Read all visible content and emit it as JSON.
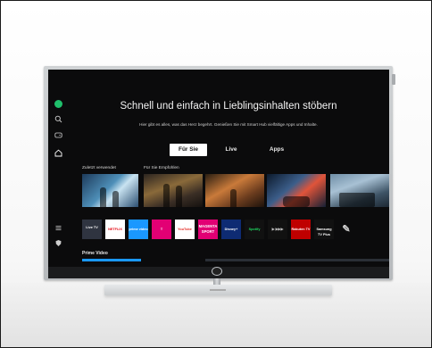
{
  "hero": {
    "headline": "Schnell und einfach in Lieblingsinhalten stöbern",
    "subline": "Hier gibt es alles, was das Herz begehrt. Genießen Sie mit Smart Hub vielfältige Apps und Inhalte."
  },
  "tabs": [
    {
      "label": "Für Sie",
      "active": true
    },
    {
      "label": "Live",
      "active": false
    },
    {
      "label": "Apps",
      "active": false
    }
  ],
  "sections": {
    "recent": "Zuletzt verwendet",
    "recommended": "Für Sie Empfohlen",
    "prime_video": "Prime Video"
  },
  "apps": [
    {
      "name": "Live TV",
      "label": "Live TV"
    },
    {
      "name": "Netflix",
      "label": "NETFLIX"
    },
    {
      "name": "Prime Video",
      "label": "prime video"
    },
    {
      "name": "MagentaTV",
      "label": "T"
    },
    {
      "name": "YouTube",
      "label": "YouTube"
    },
    {
      "name": "MagentaSport",
      "label": "MAGENTA SPORT"
    },
    {
      "name": "Disney+",
      "label": "Disney+"
    },
    {
      "name": "Spotify",
      "label": "Spotify"
    },
    {
      "name": "Rakuten Play",
      "label": "▶ ▶▶▶"
    },
    {
      "name": "Rakuten TV",
      "label": "Rakuten TV"
    },
    {
      "name": "Samsung TV Plus",
      "label": "Samsung TV Plus"
    }
  ],
  "icons": {
    "profile": "profile-icon",
    "search": "search-icon",
    "games": "gamepad-icon",
    "home": "home-icon",
    "menu": "menu-icon",
    "privacy": "shield-icon",
    "edit": "pencil-icon"
  },
  "colors": {
    "accent_profile": "#1fbf6b",
    "screen_bg": "#0b0b0c",
    "prime_blue": "#1a98ff"
  }
}
